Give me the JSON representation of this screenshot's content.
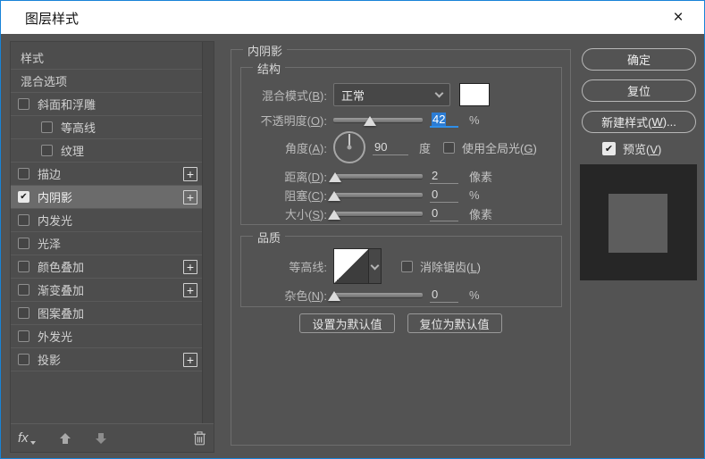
{
  "window": {
    "title": "图层样式",
    "close_glyph": "×"
  },
  "colors": {
    "window_border": "#1883d7",
    "selection_blue": "#2b7cd4",
    "focus_underline_blue": "#2f8fe9",
    "dialog_bg": "#535353",
    "sidebar_bg": "#4d4d4d",
    "selected_row_bg": "#6b6b6b",
    "preview_swatch_outer": "#262626",
    "preview_swatch_inner": "#5d5d5d",
    "blend_color_swatch": "#ffffff"
  },
  "icons": {
    "check_glyph": "✔",
    "plus_glyph": "+",
    "fx_label": "fx",
    "trash": "trash-icon",
    "arrow_up": "arrow-up-icon",
    "arrow_down": "arrow-down-icon"
  },
  "sidebar": {
    "items": [
      {
        "label": "样式",
        "checked": null,
        "selected": false
      },
      {
        "label": "混合选项",
        "checked": null,
        "selected": false
      },
      {
        "label": "斜面和浮雕",
        "checked": false,
        "selected": false
      },
      {
        "label": "等高线",
        "checked": false,
        "selected": false,
        "indent": true
      },
      {
        "label": "纹理",
        "checked": false,
        "selected": false,
        "indent": true
      },
      {
        "label": "描边",
        "checked": false,
        "selected": false,
        "plus": true
      },
      {
        "label": "内阴影",
        "checked": true,
        "selected": true,
        "plus": true
      },
      {
        "label": "内发光",
        "checked": false,
        "selected": false
      },
      {
        "label": "光泽",
        "checked": false,
        "selected": false
      },
      {
        "label": "颜色叠加",
        "checked": false,
        "selected": false,
        "plus": true
      },
      {
        "label": "渐变叠加",
        "checked": false,
        "selected": false,
        "plus": true
      },
      {
        "label": "图案叠加",
        "checked": false,
        "selected": false
      },
      {
        "label": "外发光",
        "checked": false,
        "selected": false
      },
      {
        "label": "投影",
        "checked": false,
        "selected": false,
        "plus": true
      }
    ]
  },
  "main": {
    "panel_title": "内阴影",
    "structure": {
      "legend": "结构",
      "blend_mode_label": "混合模式(B):",
      "blend_mode_value": "正常",
      "opacity_label": "不透明度(O):",
      "opacity_value": "42",
      "opacity_unit": "%",
      "opacity_pct": 41,
      "angle_label": "角度(A):",
      "angle_value": "90",
      "angle_unit": "度",
      "global_light_label": "使用全局光(G)",
      "global_light_checked": false,
      "distance_label": "距离(D):",
      "distance_value": "2",
      "distance_unit": "像素",
      "distance_pct": 2,
      "choke_label": "阻塞(C):",
      "choke_value": "0",
      "choke_unit": "%",
      "choke_pct": 1,
      "size_label": "大小(S):",
      "size_value": "0",
      "size_unit": "像素",
      "size_pct": 1
    },
    "quality": {
      "legend": "品质",
      "contour_label": "等高线:",
      "antialias_label": "消除锯齿(L)",
      "antialias_checked": false,
      "noise_label": "杂色(N):",
      "noise_value": "0",
      "noise_unit": "%",
      "noise_pct": 1
    },
    "defaults_buttons": {
      "set": "设置为默认值",
      "reset": "复位为默认值"
    }
  },
  "actions": {
    "ok": "确定",
    "reset": "复位",
    "new_style": "新建样式(W)...",
    "preview": "预览(V)",
    "preview_checked": true
  }
}
